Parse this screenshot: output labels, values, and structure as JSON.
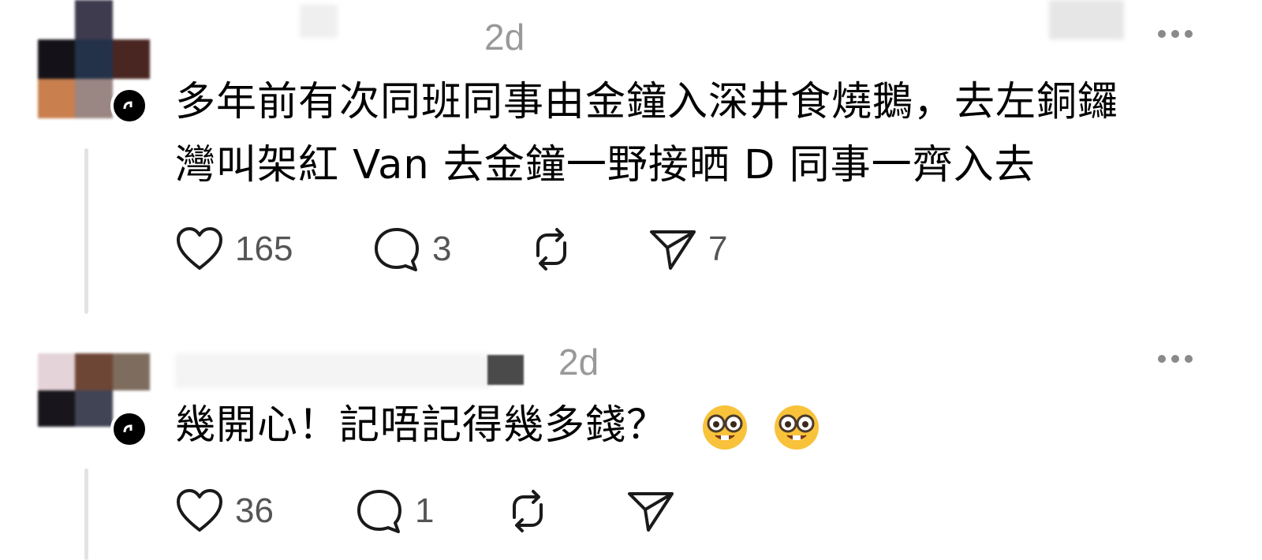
{
  "posts": [
    {
      "time": "2d",
      "text_line1": "多年前有次同班同事由金鐘入深井食燒鵝，去左銅鑼",
      "text_line2": "灣叫架紅 Van 去金鐘一野接晒 D 同事一齊入去",
      "likes": "165",
      "replies": "3",
      "shares": "7"
    },
    {
      "time": "2d",
      "text": "幾開心！記唔記得幾多錢？",
      "emoji_names": [
        "nerd-face-emoji",
        "nerd-face-emoji"
      ],
      "likes": "36",
      "replies": "1"
    }
  ],
  "icons": {
    "like": "heart-icon",
    "reply": "comment-icon",
    "repost": "repost-icon",
    "share": "send-icon",
    "more": "more-icon"
  },
  "colors": {
    "icon": "#1a1a1a",
    "muted": "#999999",
    "thread_line": "#e3e3e3"
  }
}
